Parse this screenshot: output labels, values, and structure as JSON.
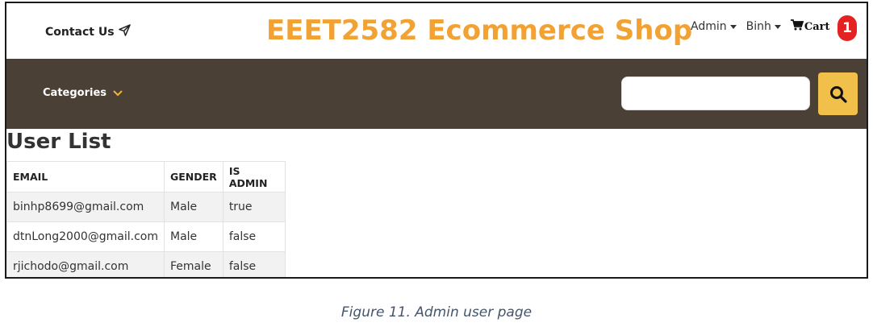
{
  "header": {
    "contact_label": "Contact Us",
    "brand": "EEET2582 Ecommerce Shop",
    "admin_menu": "Admin",
    "user_menu": "Binh",
    "cart_label": "Cart",
    "cart_count": "1"
  },
  "navbar": {
    "categories_label": "Categories",
    "search_placeholder": ""
  },
  "page": {
    "title": "User List",
    "columns": [
      "EMAIL",
      "GENDER",
      "IS ADMIN"
    ],
    "rows": [
      {
        "email": "binhp8699@gmail.com",
        "gender": "Male",
        "is_admin": "true"
      },
      {
        "email": "dtnLong2000@gmail.com",
        "gender": "Male",
        "is_admin": "false"
      },
      {
        "email": "rjichodo@gmail.com",
        "gender": "Female",
        "is_admin": "false"
      }
    ]
  },
  "caption": "Figure 11. Admin user page",
  "colors": {
    "brand": "#f2a233",
    "navbar": "#4b4035",
    "search_button": "#f0c04a",
    "badge": "#e52222"
  },
  "icons": {
    "contact": "paper-plane-icon",
    "cart": "shopping-cart-icon",
    "search": "search-icon",
    "categories": "chevron-down-icon"
  }
}
